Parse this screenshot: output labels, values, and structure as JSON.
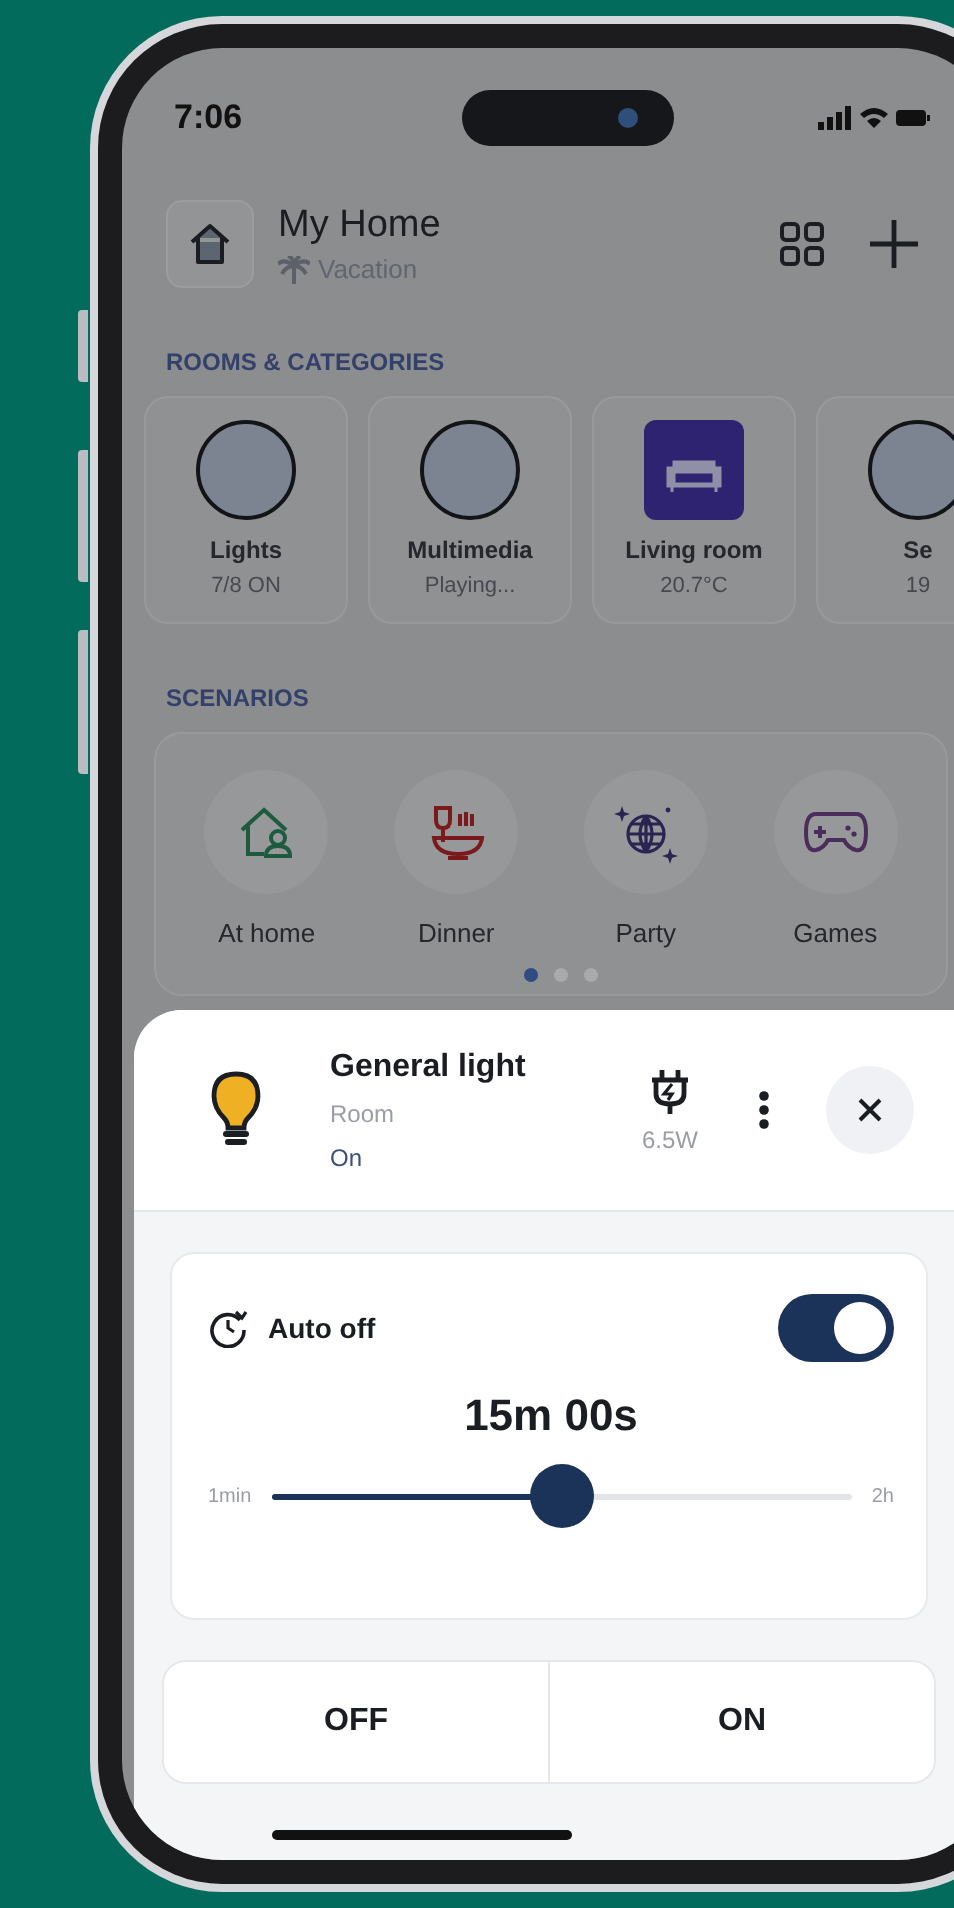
{
  "status_bar": {
    "time": "7:06"
  },
  "header": {
    "title": "My Home",
    "mode": "Vacation"
  },
  "rooms": {
    "heading": "ROOMS & CATEGORIES",
    "items": [
      {
        "kind": "circle",
        "label": "Lights",
        "status": "7/8 ON"
      },
      {
        "kind": "circle",
        "label": "Multimedia",
        "status": "Playing..."
      },
      {
        "kind": "sofa",
        "label": "Living room",
        "status": "20.7°C"
      },
      {
        "kind": "circle",
        "label": "Se",
        "status": "19"
      }
    ]
  },
  "scenarios": {
    "heading": "SCENARIOS",
    "items": [
      {
        "kind": "home",
        "label": "At home"
      },
      {
        "kind": "dinner",
        "label": "Dinner"
      },
      {
        "kind": "party",
        "label": "Party"
      },
      {
        "kind": "games",
        "label": "Games"
      }
    ],
    "pages": [
      {
        "selected": true
      },
      {
        "selected": false
      },
      {
        "selected": false
      }
    ]
  },
  "sheet": {
    "title": "General light",
    "subtitle": "Room",
    "state": "On",
    "power": "6.5W",
    "auto_off": {
      "label": "Auto off",
      "on": true,
      "duration": "15m 00s",
      "min": "1min",
      "max": "2h",
      "level": 0.5
    },
    "buttons": [
      {
        "label": "OFF"
      },
      {
        "label": "ON"
      }
    ]
  }
}
